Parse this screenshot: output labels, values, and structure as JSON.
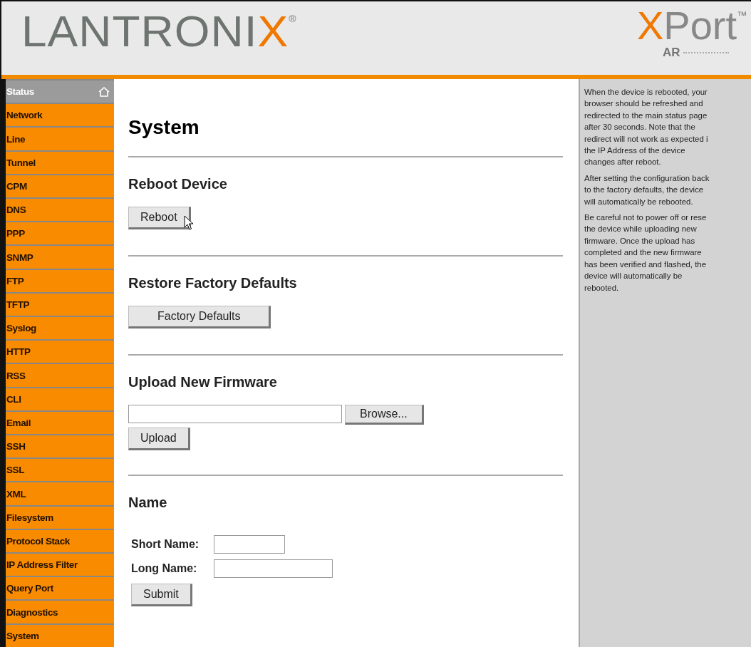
{
  "header": {
    "brand": {
      "main": "LANTRONI",
      "accent": "X",
      "mark": "®"
    },
    "product": {
      "accent": "X",
      "main": "Port",
      "mark": "™",
      "sub": "AR"
    }
  },
  "sidebar": {
    "items": [
      {
        "label": "Status",
        "kind": "home"
      },
      {
        "label": "Network",
        "kind": "link"
      },
      {
        "label": "Line",
        "kind": "link"
      },
      {
        "label": "Tunnel",
        "kind": "link"
      },
      {
        "label": "CPM",
        "kind": "link"
      },
      {
        "label": "DNS",
        "kind": "link"
      },
      {
        "label": "PPP",
        "kind": "link"
      },
      {
        "label": "SNMP",
        "kind": "link"
      },
      {
        "label": "FTP",
        "kind": "link"
      },
      {
        "label": "TFTP",
        "kind": "link"
      },
      {
        "label": "Syslog",
        "kind": "link"
      },
      {
        "label": "HTTP",
        "kind": "link"
      },
      {
        "label": "RSS",
        "kind": "link"
      },
      {
        "label": "CLI",
        "kind": "link"
      },
      {
        "label": "Email",
        "kind": "link"
      },
      {
        "label": "SSH",
        "kind": "link"
      },
      {
        "label": "SSL",
        "kind": "link"
      },
      {
        "label": "XML",
        "kind": "link"
      },
      {
        "label": "Filesystem",
        "kind": "link"
      },
      {
        "label": "Protocol Stack",
        "kind": "link"
      },
      {
        "label": "IP Address Filter",
        "kind": "link"
      },
      {
        "label": "Query Port",
        "kind": "link"
      },
      {
        "label": "Diagnostics",
        "kind": "link"
      },
      {
        "label": "System",
        "kind": "link"
      }
    ]
  },
  "main": {
    "title": "System",
    "sections": [
      {
        "heading": "Reboot Device",
        "kind": "button",
        "button": "Reboot",
        "cursor": true
      },
      {
        "heading": "Restore Factory Defaults",
        "kind": "button",
        "button": "Factory Defaults",
        "cursor": false
      },
      {
        "heading": "Upload New Firmware",
        "kind": "upload",
        "browse": "Browse...",
        "button": "Upload"
      },
      {
        "heading": "Name",
        "kind": "form",
        "fields": [
          {
            "label": "Short Name:"
          },
          {
            "label": "Long Name:"
          }
        ],
        "button": "Submit"
      }
    ]
  },
  "help": {
    "paragraphs": [
      [
        "When the device is rebooted, your",
        "browser should be refreshed and",
        "redirected to the main status page",
        "after 30 seconds. Note that the",
        "redirect will not work as expected i",
        "the IP Address of the device",
        "changes after reboot."
      ],
      [
        "After setting the configuration back",
        "to the factory defaults, the device",
        "will automatically be rebooted."
      ],
      [
        "Be careful not to power off or rese",
        "the device while uploading new",
        "firmware. Once the upload has",
        "completed and the new firmware",
        "has been verified and flashed, the",
        "device will automatically be",
        "rebooted."
      ]
    ]
  }
}
